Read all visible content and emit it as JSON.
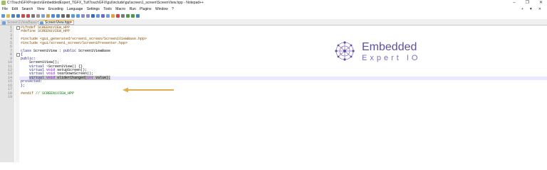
{
  "window": {
    "title": "C:\\TouchGFXProjects\\EmbeddedExpert_TGFX_Tut\\TouchGFX\\gui\\include\\gui\\screen1_screen\\ScreenView.hpp - Notepad++",
    "controls": [
      "–",
      "❐",
      "✕"
    ]
  },
  "menu": {
    "items": [
      "File",
      "Edit",
      "Search",
      "View",
      "Encoding",
      "Language",
      "Settings",
      "Tools",
      "Macro",
      "Run",
      "Plugins",
      "Window",
      "?"
    ],
    "right": [
      "+",
      "▼",
      "✕"
    ]
  },
  "tabs": [
    {
      "label": "Screen1ViewBase.hpp",
      "active": false
    },
    {
      "label": "ScreenView.hpp",
      "active": true
    }
  ],
  "editor": {
    "current_line": 14,
    "lines": [
      {
        "n": "1",
        "fold": true,
        "parts": [
          {
            "c": "pp",
            "t": "#ifndef SCREEN1VIEW_HPP"
          }
        ]
      },
      {
        "n": "2",
        "parts": [
          {
            "c": "pp",
            "t": "#define SCREEN1VIEW_HPP"
          }
        ]
      },
      {
        "n": "3",
        "parts": []
      },
      {
        "n": "4",
        "parts": [
          {
            "c": "pp",
            "t": "#include <gui_generated/screen1_screen/Screen1ViewBase.hpp>"
          }
        ]
      },
      {
        "n": "5",
        "parts": [
          {
            "c": "pp",
            "t": "#include <gui/screen1_screen/Screen1Presenter.hpp>"
          }
        ]
      },
      {
        "n": "6",
        "parts": []
      },
      {
        "n": "7",
        "parts": [
          {
            "c": "kw",
            "t": "class"
          },
          {
            "c": "tx",
            "t": " Screen1View : "
          },
          {
            "c": "kw",
            "t": "public"
          },
          {
            "c": "tx",
            "t": " Screen1ViewBase"
          }
        ]
      },
      {
        "n": "8",
        "fold": true,
        "parts": [
          {
            "c": "op",
            "t": "{"
          }
        ]
      },
      {
        "n": "9",
        "parts": [
          {
            "c": "kw",
            "t": "public"
          },
          {
            "c": "op",
            "t": ":"
          }
        ]
      },
      {
        "n": "10",
        "parts": [
          {
            "c": "tx",
            "t": "    Screen1View();"
          }
        ]
      },
      {
        "n": "11",
        "parts": [
          {
            "c": "tx",
            "t": "    "
          },
          {
            "c": "kw",
            "t": "virtual"
          },
          {
            "c": "tx",
            "t": " ~Screen1View() {}"
          }
        ]
      },
      {
        "n": "12",
        "parts": [
          {
            "c": "tx",
            "t": "    "
          },
          {
            "c": "kw",
            "t": "virtual"
          },
          {
            "c": "tx",
            "t": " "
          },
          {
            "c": "ty",
            "t": "void"
          },
          {
            "c": "tx",
            "t": " setupScreen();"
          }
        ]
      },
      {
        "n": "13",
        "parts": [
          {
            "c": "tx",
            "t": "    "
          },
          {
            "c": "kw",
            "t": "virtual"
          },
          {
            "c": "tx",
            "t": " "
          },
          {
            "c": "ty",
            "t": "void"
          },
          {
            "c": "tx",
            "t": " tearDownScreen();"
          }
        ]
      },
      {
        "n": "14",
        "parts": [
          {
            "c": "tx",
            "t": "    "
          },
          {
            "c": "kw",
            "t": "virtual"
          },
          {
            "c": "tx",
            "t": " "
          },
          {
            "c": "ty",
            "t": "void"
          },
          {
            "c": "tx",
            "t": " sliderChanged("
          },
          {
            "c": "ty",
            "t": "int"
          },
          {
            "c": "tx",
            "t": " value);"
          }
        ]
      },
      {
        "n": "15",
        "parts": [
          {
            "c": "kw",
            "t": "protected"
          },
          {
            "c": "op",
            "t": ":"
          }
        ]
      },
      {
        "n": "16",
        "parts": [
          {
            "c": "op",
            "t": "};"
          }
        ]
      },
      {
        "n": "17",
        "parts": []
      },
      {
        "n": "18",
        "parts": [
          {
            "c": "pp",
            "t": "#endif"
          },
          {
            "c": "cm",
            "t": " // SCREEN1VIEW_HPP"
          }
        ]
      },
      {
        "n": "19",
        "parts": []
      }
    ]
  },
  "logo": {
    "line1": "Embedded",
    "line2": "Expert IO",
    "colors": {
      "primary": "#5b4fa8",
      "secondary": "#7a6fc4"
    }
  },
  "annotation": {
    "icon": "arrow-left-icon",
    "color": "#e0b050"
  },
  "colors": {
    "active_tab_accent": "#f7a830",
    "current_line": "#e8e8ff",
    "selection": "#c0c0c0"
  }
}
